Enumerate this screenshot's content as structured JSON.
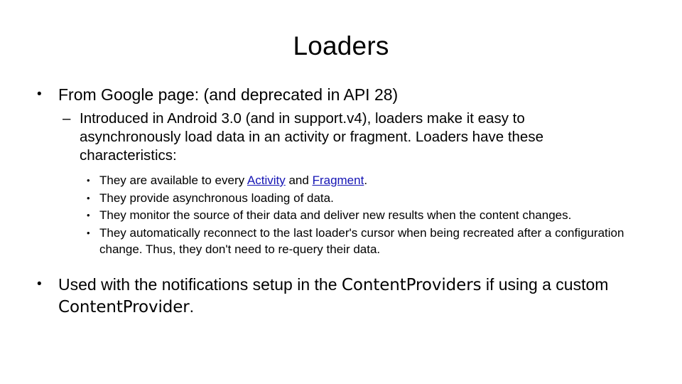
{
  "slide": {
    "title": "Loaders",
    "bullets": {
      "level1_first": {
        "marker": "•",
        "text": "From Google page:  (and deprecated in API 28)"
      },
      "level2_first": {
        "marker": "–",
        "text": "Introduced in Android 3.0 (and in support.v4), loaders make it easy to asynchronously load data in an activity or fragment. Loaders have these characteristics:"
      },
      "level3": [
        {
          "marker": "•",
          "text_before_link1": "They are available to every ",
          "link1": "Activity",
          "text_between_links": " and ",
          "link2": "Fragment",
          "text_after_link2": "."
        },
        {
          "marker": "•",
          "text": "They provide asynchronous loading of data."
        },
        {
          "marker": "•",
          "text": "They monitor the source of their data and deliver new results when the content changes."
        },
        {
          "marker": "•",
          "text": "They automatically reconnect to the last loader's cursor when being recreated after a configuration change. Thus, they don't need to re-query their data."
        }
      ],
      "level1_last": {
        "marker": "•",
        "text_part1": "Used with the notifications setup in the ",
        "code1": "ContentProviders",
        "text_part2": " if using a custom ",
        "code2": "ContentProvider",
        "text_part3": "."
      }
    },
    "colors": {
      "background": "#ffffff",
      "text": "#000000",
      "hyperlink": "#1414b4"
    }
  }
}
